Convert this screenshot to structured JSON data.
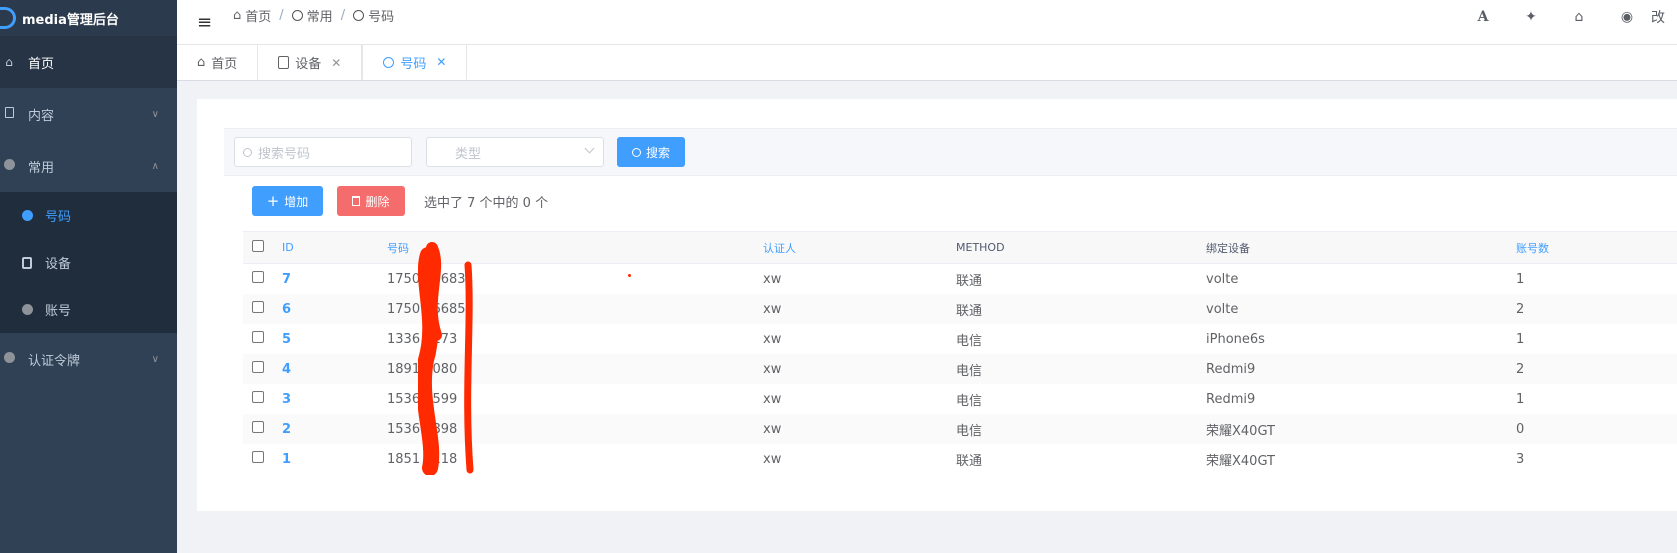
{
  "app": {
    "title": "media管理后台"
  },
  "sidebar": {
    "items": [
      {
        "label": "首页",
        "icon": "home-icon"
      },
      {
        "label": "内容",
        "icon": "document-icon"
      },
      {
        "label": "常用",
        "icon": "circle-icon"
      },
      {
        "label": "认证令牌",
        "icon": "circle-icon"
      }
    ],
    "sub_items": [
      {
        "label": "号码",
        "icon": "circle-icon",
        "active": true
      },
      {
        "label": "设备",
        "icon": "book-icon"
      },
      {
        "label": "账号",
        "icon": "circle-icon"
      }
    ]
  },
  "breadcrumb": [
    "首页",
    "常用",
    "号码"
  ],
  "navbar": {
    "right_partial_label": "改"
  },
  "tags": [
    {
      "label": "首页"
    },
    {
      "label": "设备"
    },
    {
      "label": "号码",
      "active": true
    }
  ],
  "filter": {
    "search_placeholder": "搜索号码",
    "type_placeholder": "类型",
    "search_button": "搜索"
  },
  "toolbar": {
    "add_button": "增加",
    "delete_button": "删除",
    "selected_info": "选中了 7 个中的 0 个"
  },
  "table": {
    "headers": {
      "id": "ID",
      "number": "号码",
      "auth": "认证人",
      "method": "METHOD",
      "device": "绑定设备",
      "accounts": "账号数"
    },
    "rows": [
      {
        "id": "7",
        "number": "1750  76683",
        "auth": "xw",
        "method": "联通",
        "device": "volte",
        "accounts": "1"
      },
      {
        "id": "6",
        "number": "1750  76685",
        "auth": "xw",
        "method": "联通",
        "device": "volte",
        "accounts": "2"
      },
      {
        "id": "5",
        "number": "1336  9173",
        "auth": "xw",
        "method": "电信",
        "device": "iPhone6s",
        "accounts": "1"
      },
      {
        "id": "4",
        "number": "1891  8080",
        "auth": "xw",
        "method": "电信",
        "device": "Redmi9",
        "accounts": "2"
      },
      {
        "id": "3",
        "number": "1536  2599",
        "auth": "xw",
        "method": "电信",
        "device": "Redmi9",
        "accounts": "1"
      },
      {
        "id": "2",
        "number": "1536  0898",
        "auth": "xw",
        "method": "电信",
        "device": "荣耀X40GT",
        "accounts": "0"
      },
      {
        "id": "1",
        "number": "1851  9118",
        "auth": "xw",
        "method": "联通",
        "device": "荣耀X40GT",
        "accounts": "3"
      }
    ]
  },
  "colors": {
    "sidebar_bg": "#304156",
    "accent": "#409eff",
    "danger": "#f56c6c",
    "redaction": "#ff2a00"
  }
}
